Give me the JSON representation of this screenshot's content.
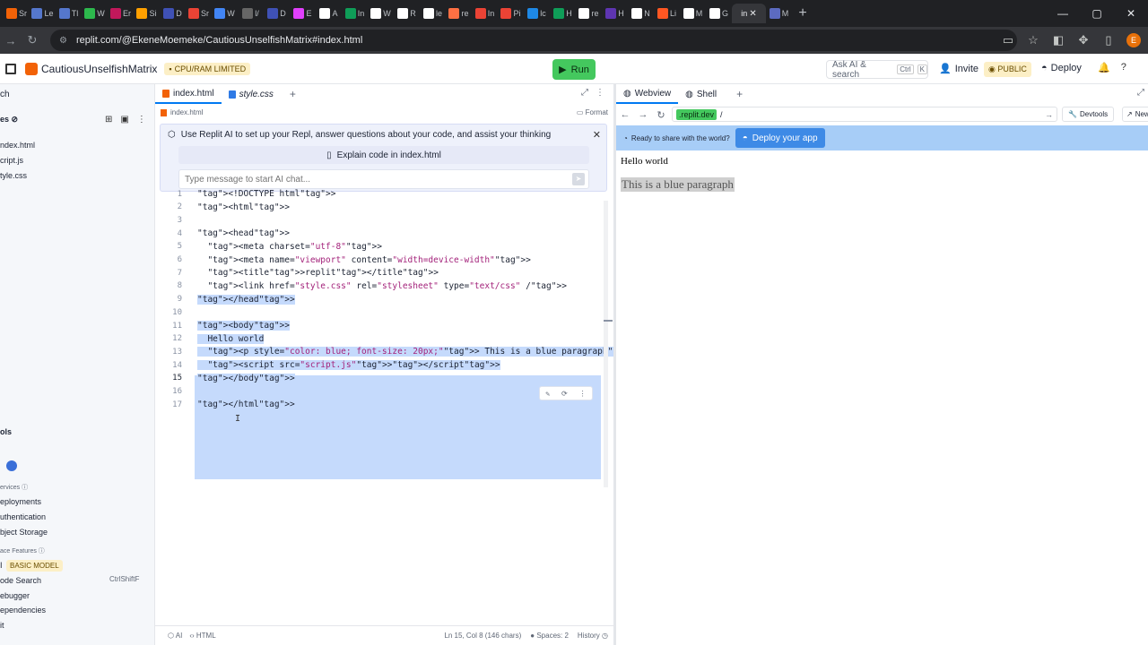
{
  "browser": {
    "tabs": [
      {
        "label": "Sr",
        "color": "#f26207"
      },
      {
        "label": "Le",
        "color": "#5577cc"
      },
      {
        "label": "Tl",
        "color": "#5577cc"
      },
      {
        "label": "W",
        "color": "#2db84d"
      },
      {
        "label": "Er",
        "color": "#c2185b"
      },
      {
        "label": "Si",
        "color": "#ffa000"
      },
      {
        "label": "D",
        "color": "#3f51b5"
      },
      {
        "label": "Sr",
        "color": "#ea4335"
      },
      {
        "label": "W",
        "color": "#4285f4"
      },
      {
        "label": "l/",
        "color": "#666666"
      },
      {
        "label": "D",
        "color": "#3f51b5"
      },
      {
        "label": "E",
        "color": "#e040fb"
      },
      {
        "label": "A",
        "color": "#ffffff"
      },
      {
        "label": "In",
        "color": "#0f9d58"
      },
      {
        "label": "W",
        "color": "#ffffff"
      },
      {
        "label": "R",
        "color": "#ffffff"
      },
      {
        "label": "le",
        "color": "#ffffff"
      },
      {
        "label": "re",
        "color": "#ff7043"
      },
      {
        "label": "In",
        "color": "#ea4335"
      },
      {
        "label": "Pi",
        "color": "#ea4335"
      },
      {
        "label": "lc",
        "color": "#1e88e5"
      },
      {
        "label": "H",
        "color": "#0f9d58"
      },
      {
        "label": "re",
        "color": "#ffffff"
      },
      {
        "label": "H",
        "color": "#5e35b1"
      },
      {
        "label": "N",
        "color": "#ffffff"
      },
      {
        "label": "Li",
        "color": "#ff5722"
      },
      {
        "label": "M",
        "color": "#ffffff"
      },
      {
        "label": "G",
        "color": "#ffffff"
      }
    ],
    "active_tab": {
      "label": "in"
    },
    "extra_tab": {
      "label": "M"
    },
    "url": "replit.com/@EkeneMoemeke/CautiousUnselfishMatrix#index.html",
    "profile_initial": "E"
  },
  "header": {
    "repl_name": "CautiousUnselfishMatrix",
    "limit_badge": "CPU/RAM LIMITED",
    "run_label": "Run",
    "ask_ai": "Ask AI & search",
    "ask_ai_kbd": "Ctrl",
    "ask_ai_kbd2": "K",
    "invite": "Invite",
    "public_badge": "PUBLIC",
    "deploy": "Deploy"
  },
  "sidebar": {
    "search": "ch",
    "files_title": "es",
    "files": [
      "ndex.html",
      "cript.js",
      "tyle.css"
    ],
    "tools_title": "ols",
    "services_label": "ervices",
    "services": [
      "eployments",
      "uthentication",
      "bject Storage"
    ],
    "workspace_label": "ace Features",
    "ai_label": "I",
    "basic_model": "BASIC MODEL",
    "features": [
      "ode Search",
      "ebugger",
      "ependencies",
      "it"
    ],
    "code_search_shortcut": "CtrlShiftF"
  },
  "editor": {
    "tabs": [
      "index.html",
      "style.css"
    ],
    "breadcrumb": "index.html",
    "format": "Format",
    "ai_message": "Use Replit AI to set up your Repl, answer questions about your code, and assist your thinking",
    "explain": "Explain code in index.html",
    "ai_placeholder": "Type message to start AI chat...",
    "status_ai": "AI",
    "status_lang": "HTML",
    "status_pos": "Ln 15, Col 8 (146 chars)",
    "status_spaces": "Spaces: 2",
    "status_history": "History"
  },
  "code": {
    "lines": [
      {
        "n": "1",
        "html": "&lt;!DOCTYPE html&gt;"
      },
      {
        "n": "2",
        "html": "&lt;html&gt;"
      },
      {
        "n": "3",
        "html": ""
      },
      {
        "n": "4",
        "html": "&lt;head&gt;"
      },
      {
        "n": "5",
        "html": "  &lt;meta charset=\"utf-8\"&gt;"
      },
      {
        "n": "6",
        "html": "  &lt;meta name=\"viewport\" content=\"width=device-width\"&gt;"
      },
      {
        "n": "7",
        "html": "  &lt;title&gt;replit&lt;/title&gt;"
      },
      {
        "n": "8",
        "html": "  &lt;link href=\"style.css\" rel=\"stylesheet\" type=\"text/css\" /&gt;"
      },
      {
        "n": "9",
        "html": "&lt;/head&gt;"
      },
      {
        "n": "10",
        "html": ""
      },
      {
        "n": "11",
        "html": "&lt;body&gt;"
      },
      {
        "n": "12",
        "html": "  Hello world"
      },
      {
        "n": "13",
        "html": "  &lt;p style=\"color: blue; font-size: 20px;\"&gt; This is a blue paragraph&lt;/p&gt;"
      },
      {
        "n": "14",
        "html": "  &lt;script src=\"script.js\"&gt;&lt;/script&gt;"
      },
      {
        "n": "15",
        "html": "&lt;/body&gt;"
      },
      {
        "n": "16",
        "html": ""
      },
      {
        "n": "17",
        "html": "&lt;/html&gt;"
      }
    ]
  },
  "webview": {
    "tabs": [
      "Webview",
      "Shell"
    ],
    "url_host": ".replit.dev",
    "url_path": "/",
    "devtools": "Devtools",
    "new_tab": "New",
    "ready_msg": "Ready to share with the world?",
    "deploy_btn": "Deploy your app",
    "hello": "Hello world",
    "blue_p": "This is a blue paragraph"
  }
}
